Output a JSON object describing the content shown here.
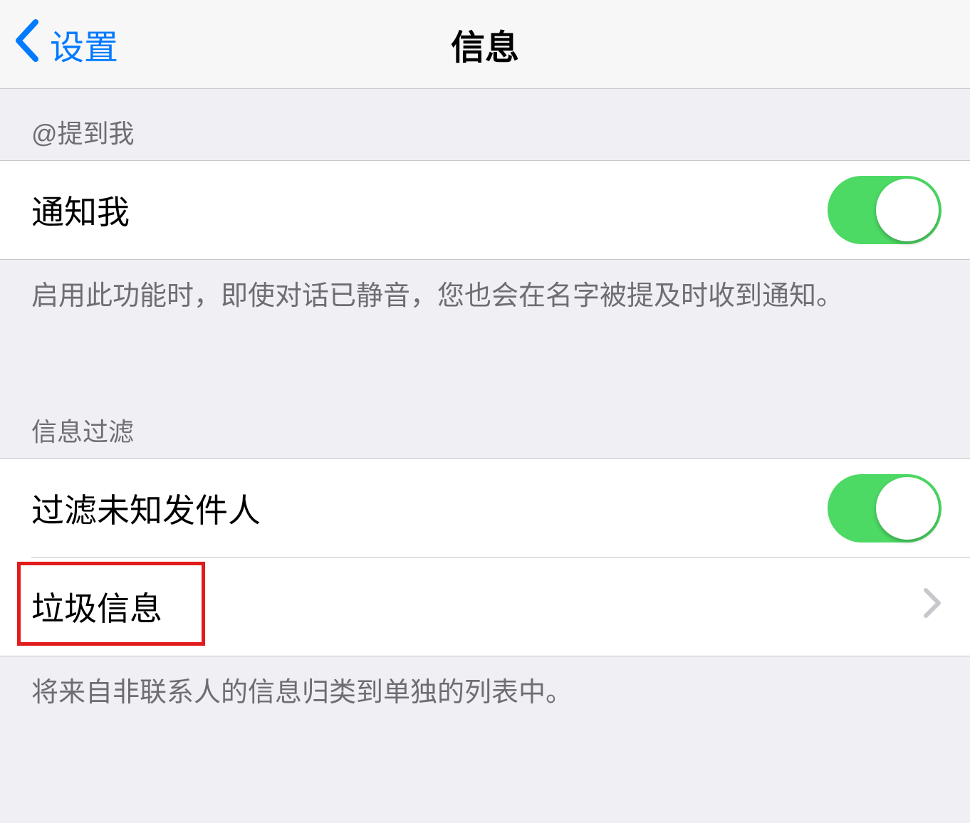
{
  "nav": {
    "back_label": "设置",
    "title": "信息"
  },
  "sections": {
    "mention": {
      "header": "@提到我",
      "notify_me": {
        "label": "通知我",
        "on": true
      },
      "footer": "启用此功能时，即使对话已静音，您也会在名字被提及时收到通知。"
    },
    "filter": {
      "header": "信息过滤",
      "unknown": {
        "label": "过滤未知发件人",
        "on": true
      },
      "junk": {
        "label": "垃圾信息"
      },
      "footer": "将来自非联系人的信息归类到单独的列表中。"
    }
  }
}
